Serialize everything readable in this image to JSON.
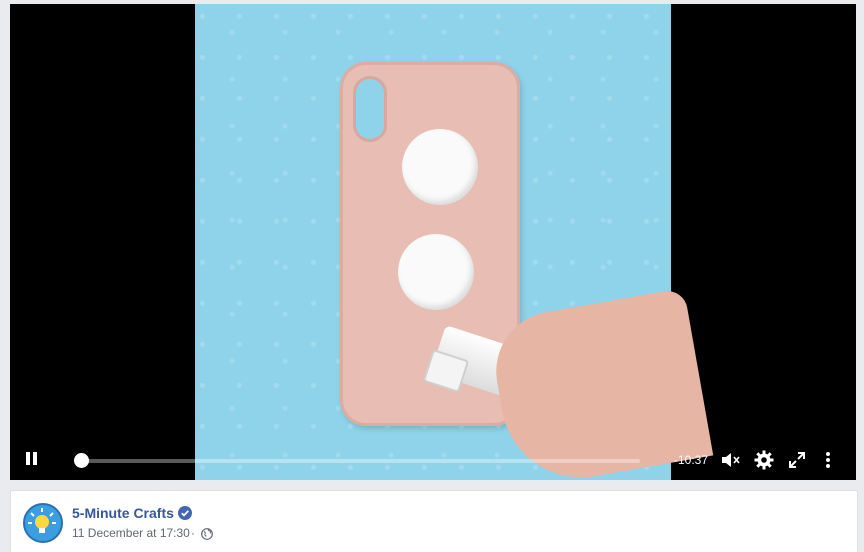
{
  "video": {
    "time_remaining": "-10:37",
    "progress": 0.005,
    "icons": {
      "pause": "pause-icon",
      "volume": "volume-muted-icon",
      "settings": "gear-icon",
      "fullscreen": "fullscreen-icon",
      "more": "more-vertical-icon"
    }
  },
  "post": {
    "page_name": "5-Minute Crafts",
    "verified": true,
    "timestamp": "11 December at 17:30",
    "separator": "·",
    "privacy_icon": "globe-icon"
  },
  "colors": {
    "link": "#365899",
    "meta": "#616770",
    "verified": "#4267b2",
    "background": "#e9ebee"
  }
}
